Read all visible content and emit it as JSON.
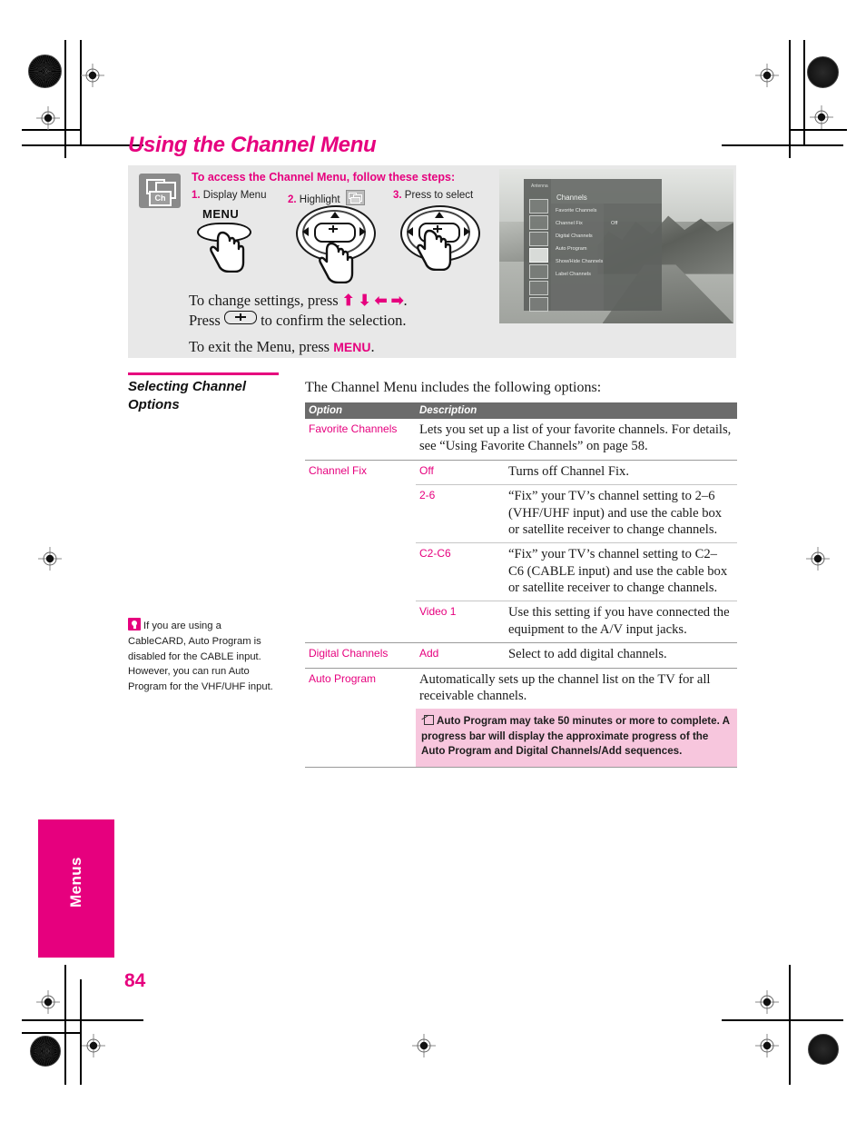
{
  "page": {
    "title": "Using the Channel Menu",
    "number": "84",
    "section_tab": "Menus"
  },
  "access_panel": {
    "badge_label": "Ch",
    "heading": "To access the Channel Menu, follow these steps:",
    "steps": [
      {
        "num": "1.",
        "label": "Display Menu"
      },
      {
        "num": "2.",
        "label": "Highlight"
      },
      {
        "num": "3.",
        "label": "Press to select"
      }
    ],
    "menu_button_label": "MENU",
    "change_settings_prefix": "To change settings, press",
    "arrows": "⬆ ⬇ ⬅ ➡",
    "change_settings_suffix": ".",
    "confirm_prefix": "Press",
    "confirm_suffix": "to confirm the selection.",
    "exit_prefix": "To exit the Menu, press",
    "exit_key": "MENU",
    "exit_suffix": "."
  },
  "tv_screen": {
    "antenna_label": "Antenna",
    "menu_title": "Channels",
    "items": [
      {
        "label": "Favorite Channels",
        "value": ""
      },
      {
        "label": "Channel Fix",
        "value": "Off"
      },
      {
        "label": "Digital Channels",
        "value": ""
      },
      {
        "label": "Auto Program",
        "value": ""
      },
      {
        "label": "Show/Hide Channels",
        "value": ""
      },
      {
        "label": "Label Channels",
        "value": ""
      }
    ],
    "rail_icons": [
      "person-icon",
      "palette-icon",
      "screen-icon",
      "channel-icon",
      "lock-icon",
      "toolbox-icon",
      "grid-icon"
    ],
    "selected_rail_index": 3
  },
  "side_heading": "Selecting Channel Options",
  "tip_note": {
    "icon": "lightbulb-icon",
    "text": "If you are using a CableCARD, Auto Program is disabled for the CABLE input. However, you can run Auto Program for the VHF/UHF input."
  },
  "options": {
    "intro": "The Channel Menu includes the following options:",
    "columns": [
      "Option",
      "Description"
    ],
    "rows": [
      {
        "option": "Favorite Channels",
        "value": "",
        "description": "Lets you set up a list of your favorite channels. For details, see “Using Favorite Channels” on page 58."
      },
      {
        "option": "Channel Fix",
        "value": "Off",
        "description": "Turns off Channel Fix."
      },
      {
        "option": "",
        "value": "2-6",
        "description": "“Fix” your TV’s channel setting to 2–6 (VHF/UHF input) and use the cable box or satellite receiver to change channels."
      },
      {
        "option": "",
        "value": "C2-C6",
        "description": "“Fix” your TV’s channel setting to C2–C6 (CABLE input) and use the cable box or satellite receiver to change channels."
      },
      {
        "option": "",
        "value": "Video 1",
        "description": "Use this setting if you have connected the equipment to the A/V input jacks."
      },
      {
        "option": "Digital Channels",
        "value": "Add",
        "description": "Select to add digital channels."
      },
      {
        "option": "Auto Program",
        "value": "",
        "description": "Automatically sets up the channel list on the TV for all receivable channels."
      }
    ],
    "callout": "Auto Program may take 50 minutes or more to complete. A progress bar will display the approximate progress of the Auto Program and Digital Channels/Add sequences."
  },
  "colors": {
    "accent_magenta": "#e6007e",
    "callout_pink": "#f7c6dd",
    "table_header_gray": "#6b6b6b",
    "panel_gray": "#e8e8e8"
  }
}
